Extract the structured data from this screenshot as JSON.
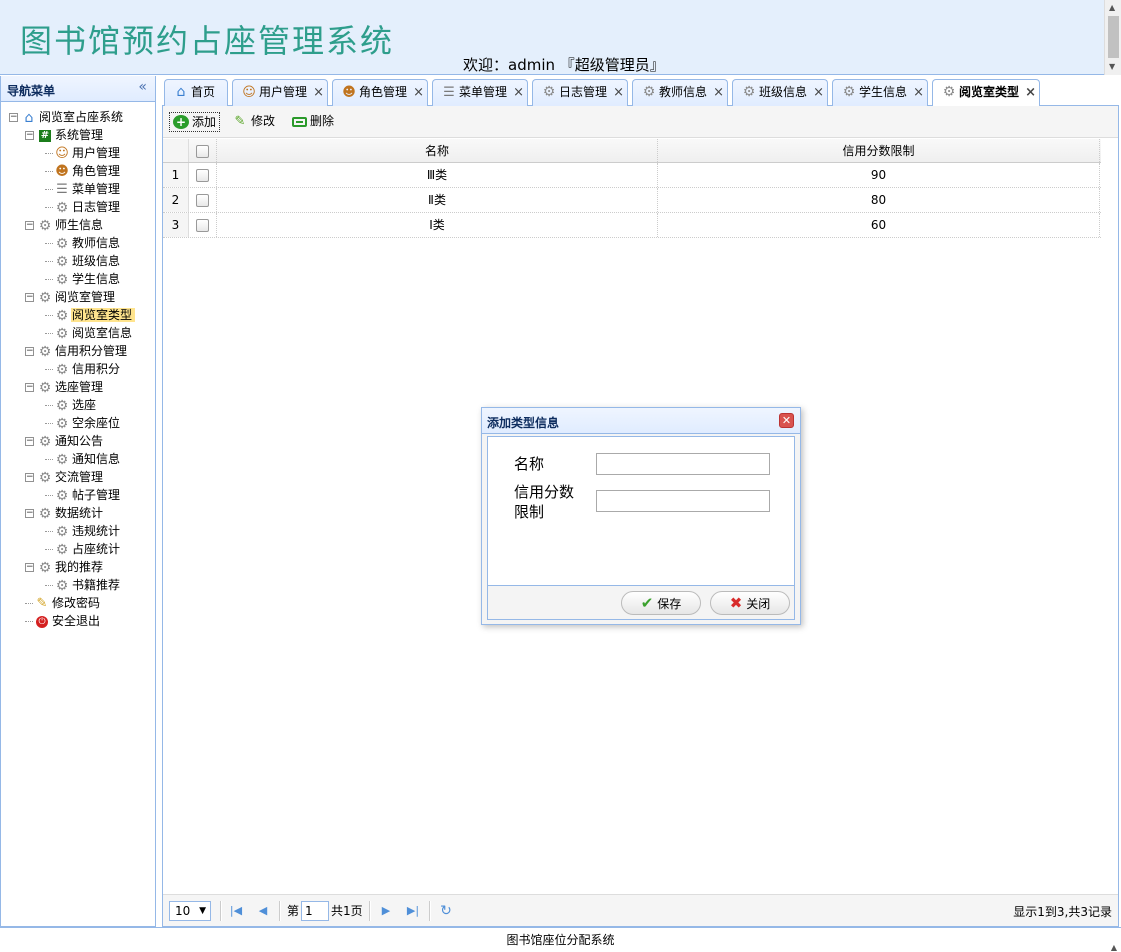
{
  "header": {
    "title": "图书馆预约占座管理系统",
    "welcome": "欢迎：admin 『超级管理员』"
  },
  "sidebar": {
    "title": "导航菜单",
    "tree": [
      {
        "label": "阅览室占座系统",
        "level": 0,
        "icon": "home-icon",
        "toggle": "⊟"
      },
      {
        "label": "系统管理",
        "level": 1,
        "icon": "hash-icon",
        "toggle": "⊟"
      },
      {
        "label": "用户管理",
        "level": 2,
        "icon": "user-icon"
      },
      {
        "label": "角色管理",
        "level": 2,
        "icon": "role-icon"
      },
      {
        "label": "菜单管理",
        "level": 2,
        "icon": "menu-icon"
      },
      {
        "label": "日志管理",
        "level": 2,
        "icon": "gear-icon"
      },
      {
        "label": "师生信息",
        "level": 1,
        "icon": "gear-icon",
        "toggle": "⊟"
      },
      {
        "label": "教师信息",
        "level": 2,
        "icon": "gear-icon"
      },
      {
        "label": "班级信息",
        "level": 2,
        "icon": "gear-icon"
      },
      {
        "label": "学生信息",
        "level": 2,
        "icon": "gear-icon"
      },
      {
        "label": "阅览室管理",
        "level": 1,
        "icon": "gear-icon",
        "toggle": "⊟"
      },
      {
        "label": "阅览室类型",
        "level": 2,
        "icon": "gear-icon",
        "selected": true
      },
      {
        "label": "阅览室信息",
        "level": 2,
        "icon": "gear-icon"
      },
      {
        "label": "信用积分管理",
        "level": 1,
        "icon": "gear-icon",
        "toggle": "⊟"
      },
      {
        "label": "信用积分",
        "level": 2,
        "icon": "gear-icon"
      },
      {
        "label": "选座管理",
        "level": 1,
        "icon": "gear-icon",
        "toggle": "⊟"
      },
      {
        "label": "选座",
        "level": 2,
        "icon": "gear-icon"
      },
      {
        "label": "空余座位",
        "level": 2,
        "icon": "gear-icon"
      },
      {
        "label": "通知公告",
        "level": 1,
        "icon": "gear-icon",
        "toggle": "⊟"
      },
      {
        "label": "通知信息",
        "level": 2,
        "icon": "gear-icon"
      },
      {
        "label": "交流管理",
        "level": 1,
        "icon": "gear-icon",
        "toggle": "⊟"
      },
      {
        "label": "帖子管理",
        "level": 2,
        "icon": "gear-icon"
      },
      {
        "label": "数据统计",
        "level": 1,
        "icon": "gear-icon",
        "toggle": "⊟"
      },
      {
        "label": "违规统计",
        "level": 2,
        "icon": "gear-icon"
      },
      {
        "label": "占座统计",
        "level": 2,
        "icon": "gear-icon"
      },
      {
        "label": "我的推荐",
        "level": 1,
        "icon": "gear-icon",
        "toggle": "⊟"
      },
      {
        "label": "书籍推荐",
        "level": 2,
        "icon": "gear-icon"
      },
      {
        "label": "修改密码",
        "level": 1,
        "icon": "password-icon"
      },
      {
        "label": "安全退出",
        "level": 1,
        "icon": "exit-icon"
      }
    ]
  },
  "tabs": [
    {
      "label": "首页",
      "icon": "home-icon",
      "closable": false
    },
    {
      "label": "用户管理",
      "icon": "user-icon",
      "closable": true
    },
    {
      "label": "角色管理",
      "icon": "role-icon",
      "closable": true
    },
    {
      "label": "菜单管理",
      "icon": "menu-icon",
      "closable": true
    },
    {
      "label": "日志管理",
      "icon": "gear-icon",
      "closable": true
    },
    {
      "label": "教师信息",
      "icon": "gear-icon",
      "closable": true
    },
    {
      "label": "班级信息",
      "icon": "gear-icon",
      "closable": true
    },
    {
      "label": "学生信息",
      "icon": "gear-icon",
      "closable": true
    },
    {
      "label": "阅览室类型",
      "icon": "gear-icon",
      "closable": true,
      "active": true
    }
  ],
  "toolbar": {
    "add_label": "添加",
    "edit_label": "修改",
    "delete_label": "删除"
  },
  "grid": {
    "columns": [
      "名称",
      "信用分数限制"
    ],
    "rows": [
      {
        "num": "1",
        "name": "Ⅲ类",
        "limit": "90"
      },
      {
        "num": "2",
        "name": "Ⅱ类",
        "limit": "80"
      },
      {
        "num": "3",
        "name": "Ⅰ类",
        "limit": "60"
      }
    ]
  },
  "pager": {
    "page_size": "10",
    "page_prefix": "第",
    "page_value": "1",
    "page_total": "共1页",
    "info": "显示1到3,共3记录"
  },
  "dialog": {
    "title": "添加类型信息",
    "name_label": "名称",
    "limit_label_line1": "信用分数",
    "limit_label_line2": "限制",
    "name_value": "",
    "limit_value": "",
    "save_label": "保存",
    "close_label": "关闭"
  },
  "footer": {
    "text": "图书馆座位分配系统"
  },
  "colors": {
    "border": "#95b8e7",
    "header_bg": "#e4effc",
    "title": "#2e9e8c",
    "selected": "#ffe48d"
  }
}
